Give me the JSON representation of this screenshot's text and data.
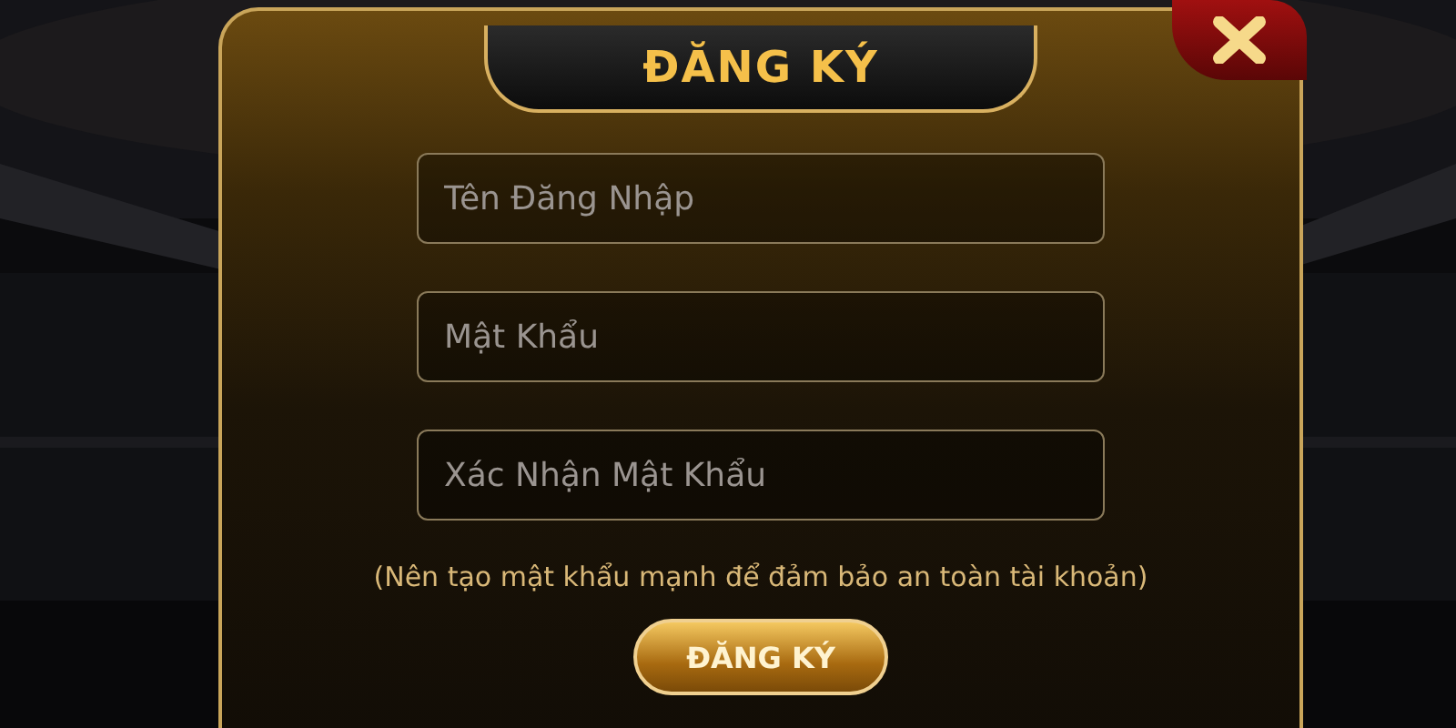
{
  "dialog": {
    "title": "ĐĂNG KÝ",
    "fields": [
      {
        "placeholder": "Tên Đăng Nhập"
      },
      {
        "placeholder": "Mật Khẩu"
      },
      {
        "placeholder": "Xác Nhận Mật Khẩu"
      }
    ],
    "hint": "(Nên tạo mật khẩu mạnh để đảm bảo an toàn tài khoản)",
    "submit": "ĐĂNG KÝ"
  }
}
